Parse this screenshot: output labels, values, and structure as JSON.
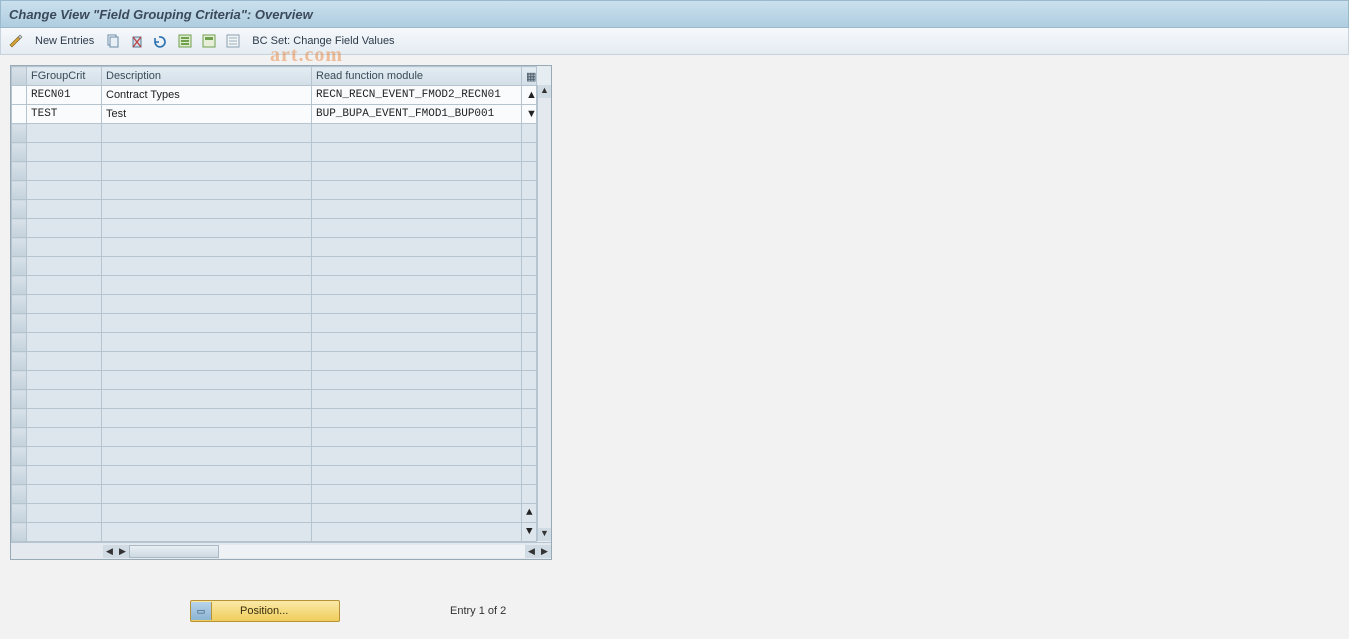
{
  "title": "Change View \"Field Grouping Criteria\": Overview",
  "watermark": "art.com",
  "toolbar": {
    "new_entries": "New Entries",
    "bc_set": "BC Set: Change Field Values"
  },
  "columns": {
    "crit": "FGroupCrit",
    "desc": "Description",
    "mod": "Read function module"
  },
  "rows": [
    {
      "crit": "RECN01",
      "desc": "Contract Types",
      "mod": "RECN_RECN_EVENT_FMOD2_RECN01",
      "selected": true
    },
    {
      "crit": "TEST",
      "desc": "Test",
      "mod": "BUP_BUPA_EVENT_FMOD1_BUP001",
      "selected": false
    }
  ],
  "footer": {
    "position_label": "Position...",
    "entry_text": "Entry 1 of 2"
  }
}
